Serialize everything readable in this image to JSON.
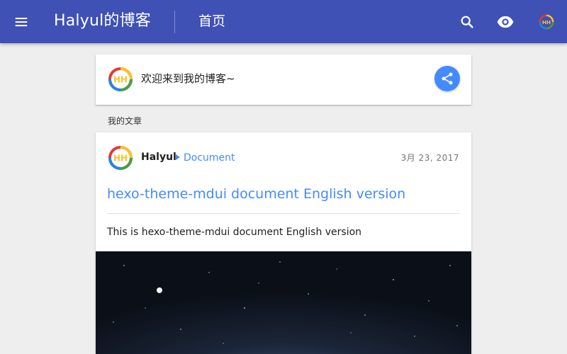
{
  "appbar": {
    "site_title": "Halyul的博客",
    "page_label": "首页",
    "icons": [
      "menu-icon",
      "search-icon",
      "eye-icon",
      "avatar-logo-icon"
    ]
  },
  "welcome": {
    "text": "欢迎来到我的博客~",
    "share_icon": "share-icon"
  },
  "section": {
    "label": "我的文章"
  },
  "post": {
    "author": "Halyul",
    "category": "Document",
    "date": "3月 23, 2017",
    "title": "hexo-theme-mdui document English version",
    "excerpt": "This is hexo-theme-mdui document English version"
  },
  "colors": {
    "primary": "#3f51b5",
    "accent": "#448aff",
    "background": "#eeeeee"
  }
}
